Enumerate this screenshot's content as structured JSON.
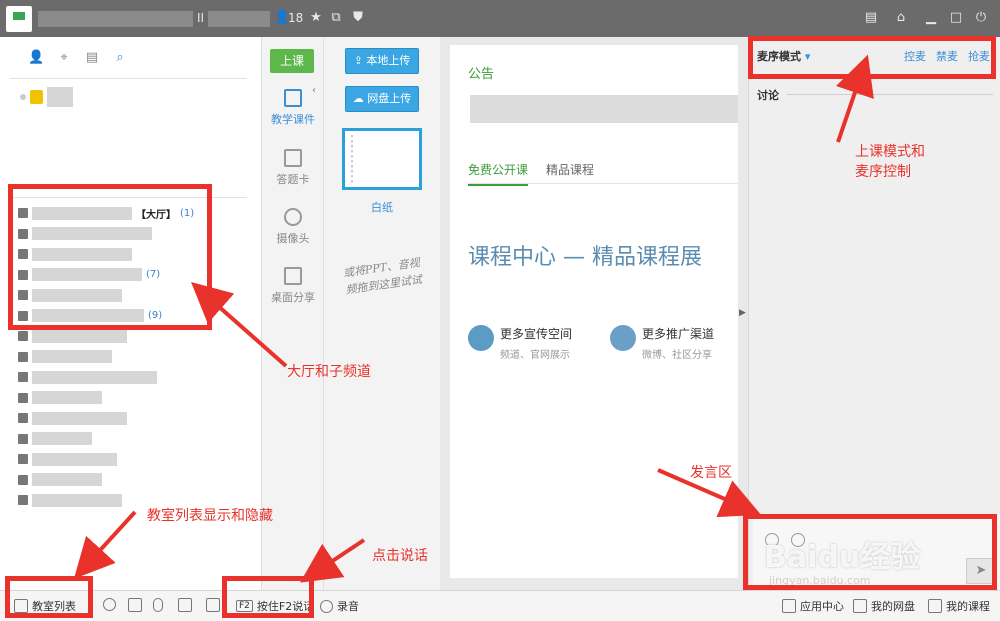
{
  "titlebar": {
    "id_prefix": "II",
    "member_count": "18"
  },
  "left": {
    "hall_label": "【大厅】",
    "channels": [
      {
        "count": "(1)",
        "hall": true
      },
      {
        "count": "",
        "hall": false
      },
      {
        "count": "",
        "hall": false
      },
      {
        "count": "(7)",
        "hall": false
      },
      {
        "count": "",
        "hall": false
      },
      {
        "count": "(9)",
        "hall": false
      },
      {
        "count": "",
        "hall": false
      },
      {
        "count": "",
        "hall": false
      },
      {
        "count": "",
        "hall": false
      },
      {
        "count": "",
        "hall": false
      },
      {
        "count": "",
        "hall": false
      },
      {
        "count": "",
        "hall": false
      },
      {
        "count": "",
        "hall": false
      },
      {
        "count": "",
        "hall": false
      },
      {
        "count": "",
        "hall": false
      }
    ]
  },
  "tools": {
    "class_button": "上课",
    "items": [
      "教学课件",
      "答题卡",
      "摄像头",
      "桌面分享"
    ]
  },
  "upload": {
    "local_upload": "本地上传",
    "cloud_upload": "网盘上传",
    "whiteboard": "白纸",
    "hint": "或将PPT、音视频拖到这里试试"
  },
  "center": {
    "notice_title": "公告",
    "tabs": [
      "免费公开课",
      "精品课程"
    ],
    "course_center": "课程中心 — 精品课程展",
    "promo1_title": "更多宣传空间",
    "promo1_sub": "频道、官网展示",
    "promo2_title": "更多推广渠道",
    "promo2_sub": "微博、社区分享"
  },
  "right": {
    "mic_mode": "麦序模式",
    "links": [
      "控麦",
      "禁麦",
      "抢麦"
    ],
    "discussion": "讨论",
    "watermark": "Baidu经验",
    "watermark_sub": "jingyan.baidu.com"
  },
  "bottombar": {
    "classroom_list": "教室列表",
    "f2_key": "F2",
    "push_to_talk": "按住F2说话",
    "record": "录音",
    "app_center": "应用中心",
    "my_drive": "我的网盘",
    "my_courses": "我的课程"
  },
  "annotations": {
    "mode_control": "上课模式和\n麦序控制",
    "hall_channels": "大厅和子频道",
    "speak_area": "发言区",
    "list_toggle": "教室列表显示和隐藏",
    "click_talk": "点击说话"
  },
  "colors": {
    "annotation_red": "#e8322b",
    "accent_blue": "#3b8fd6",
    "accent_green": "#5db84b"
  }
}
